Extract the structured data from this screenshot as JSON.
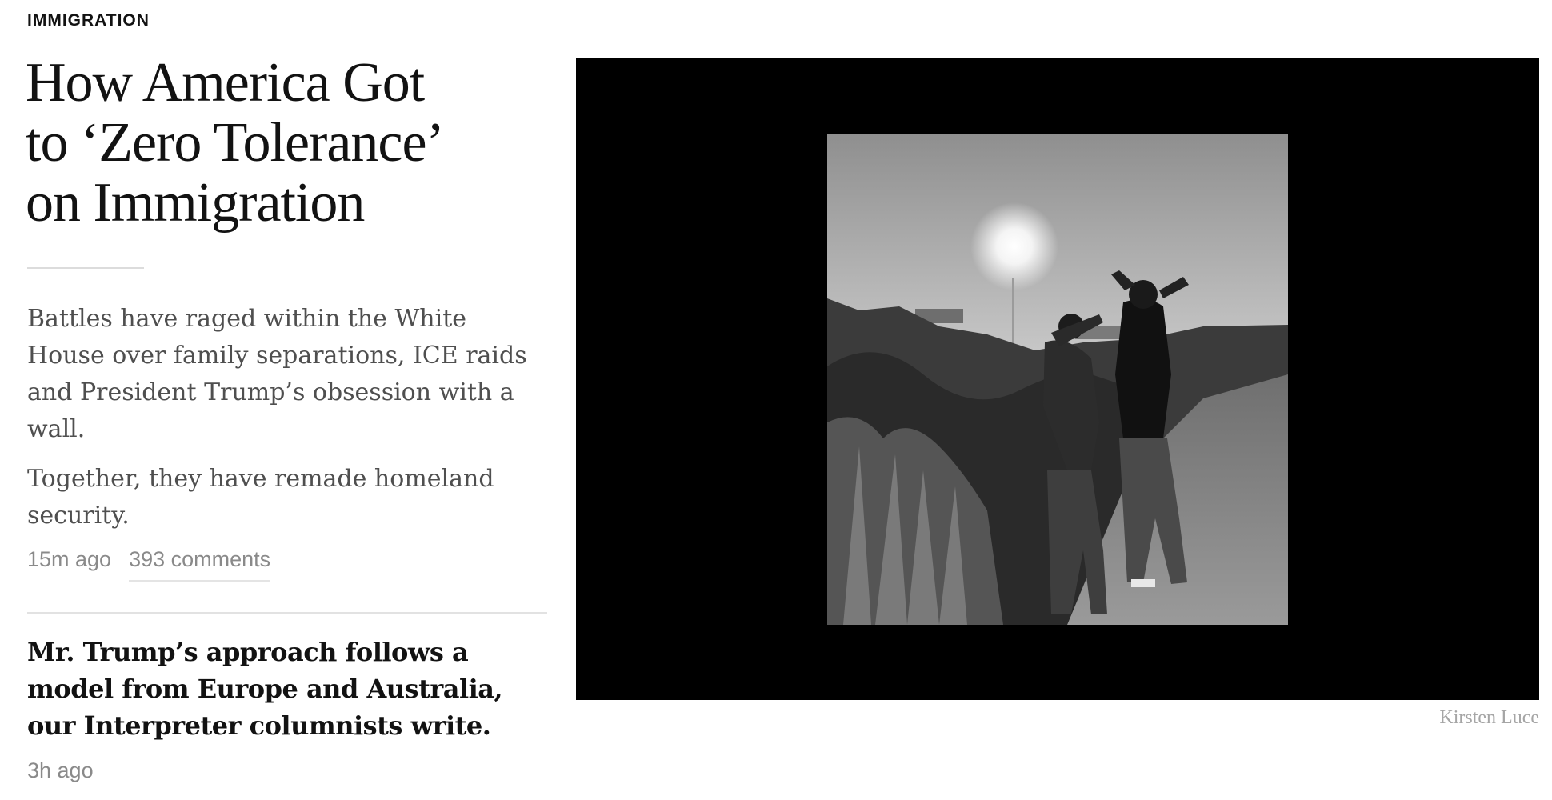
{
  "article": {
    "kicker": "IMMIGRATION",
    "headline_lines": [
      "How America Got",
      "to ‘Zero Tolerance’",
      "on Immigration"
    ],
    "summary_paragraphs": [
      "Battles have raged within the White House over family separations, ICE raids and President Trump’s obsession with a wall.",
      "Together, they have remade homeland security."
    ],
    "timestamp": "15m ago",
    "comments": "393 comments"
  },
  "related": {
    "headline": "Mr. Trump’s approach follows a model from Europe and Australia, our Interpreter columnists write.",
    "timestamp": "3h ago"
  },
  "media": {
    "credit": "Kirsten Luce",
    "frame_color": "#000000"
  },
  "colors": {
    "headline": "#121212",
    "summary": "#4f4f4f",
    "meta": "#8a8a8a",
    "credit": "#a5a5a5"
  }
}
